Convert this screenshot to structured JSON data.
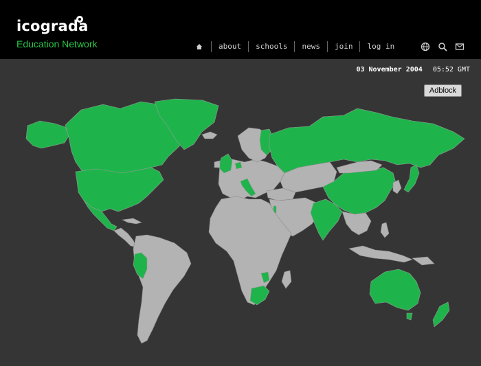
{
  "brand": {
    "name": "icograda",
    "tagline": "Education Network"
  },
  "nav": {
    "about": "about",
    "schools": "schools",
    "news": "news",
    "join": "join",
    "login": "log in"
  },
  "icons": {
    "home": "home-icon",
    "globe": "globe-icon",
    "search": "search-icon",
    "mail": "mail-icon"
  },
  "status": {
    "date": "03 November 2004",
    "time": "05:52 GMT"
  },
  "adblock_label": "Adblock",
  "map": {
    "colors": {
      "active": "#1fb44b",
      "inactive": "#b3b3b3",
      "background": "#353535"
    }
  }
}
